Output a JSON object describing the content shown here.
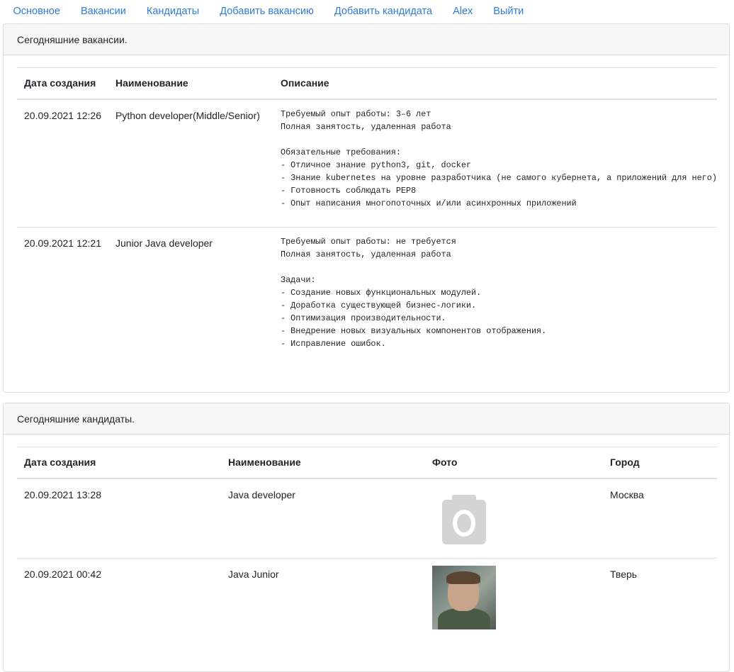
{
  "nav": {
    "items": [
      "Основное",
      "Вакансии",
      "Кандидаты",
      "Добавить вакансию",
      "Добавить кандидата",
      "Alex",
      "Выйти"
    ]
  },
  "vacancies": {
    "title": "Сегодняшние вакансии.",
    "headers": [
      "Дата создания",
      "Наименование",
      "Описание"
    ],
    "rows": [
      {
        "date": "20.09.2021 12:26",
        "name": "Python developer(Middle/Senior)",
        "description": "Требуемый опыт работы: 3–6 лет\nПолная занятость, удаленная работа\n\nОбязательные требования:\n- Отличное знание python3, git, docker\n- Знание kubernetes на уровне разработчика (не самого кубернета, а приложений для него)\n- Готовность соблюдать PEP8\n- Опыт написания многопоточных и/или асинхронных приложений"
      },
      {
        "date": "20.09.2021 12:21",
        "name": "Junior Java developer",
        "description": "Требуемый опыт работы: не требуется\nПолная занятость, удаленная работа\n\nЗадачи:\n- Создание новых функциональных модулей.\n- Доработка существующей бизнес-логики.\n- Оптимизация производительности.\n- Внедрение новых визуальных компонентов отображения.\n- Исправление ошибок."
      }
    ]
  },
  "candidates": {
    "title": "Сегодняшние кандидаты.",
    "headers": [
      "Дата создания",
      "Наименование",
      "Фото",
      "Город"
    ],
    "rows": [
      {
        "date": "20.09.2021 13:28",
        "name": "Java developer",
        "photo": "camera-placeholder-icon",
        "city": "Москва"
      },
      {
        "date": "20.09.2021 00:42",
        "name": "Java Junior",
        "photo": "user-photo",
        "city": "Тверь"
      }
    ]
  },
  "colors": {
    "link": "#2f7bd9",
    "header_bg": "#f7f7f7",
    "border": "#dee2e6",
    "placeholder_icon": "#d4d4d4"
  }
}
